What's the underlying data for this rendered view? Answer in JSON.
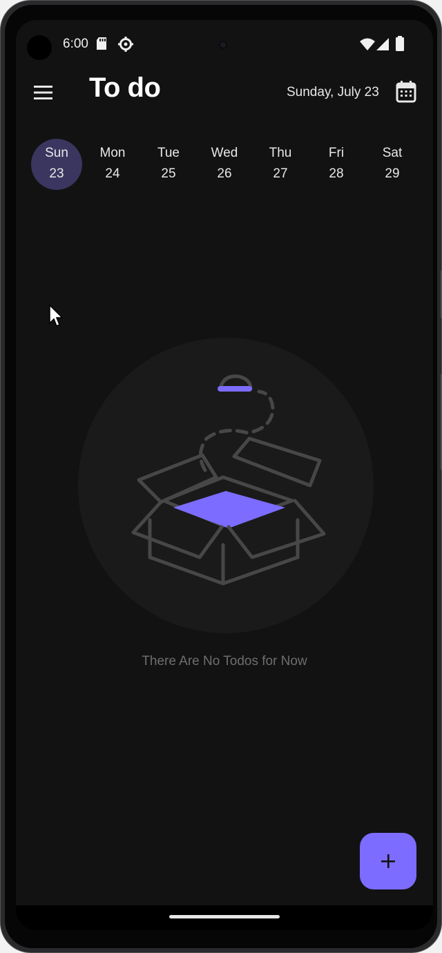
{
  "status_bar": {
    "time": "6:00",
    "icons": [
      "sd-card-icon",
      "settings-icon",
      "wifi-icon",
      "signal-icon",
      "battery-icon"
    ]
  },
  "app_bar": {
    "menu_icon": "menu-icon",
    "title": "To do",
    "date_label": "Sunday, July 23",
    "calendar_icon": "calendar-icon"
  },
  "week": {
    "days": [
      {
        "name": "Sun",
        "num": "23",
        "selected": true
      },
      {
        "name": "Mon",
        "num": "24",
        "selected": false
      },
      {
        "name": "Tue",
        "num": "25",
        "selected": false
      },
      {
        "name": "Wed",
        "num": "26",
        "selected": false
      },
      {
        "name": "Thu",
        "num": "27",
        "selected": false
      },
      {
        "name": "Fri",
        "num": "28",
        "selected": false
      },
      {
        "name": "Sat",
        "num": "29",
        "selected": false
      }
    ]
  },
  "empty_state": {
    "illustration": "open-box-icon",
    "message": "There Are No Todos for Now"
  },
  "fab": {
    "icon": "plus-icon"
  },
  "colors": {
    "background": "#121212",
    "accent": "#7c6cff",
    "selected_day": "#3a3660",
    "empty_text": "#6e6e6e"
  }
}
